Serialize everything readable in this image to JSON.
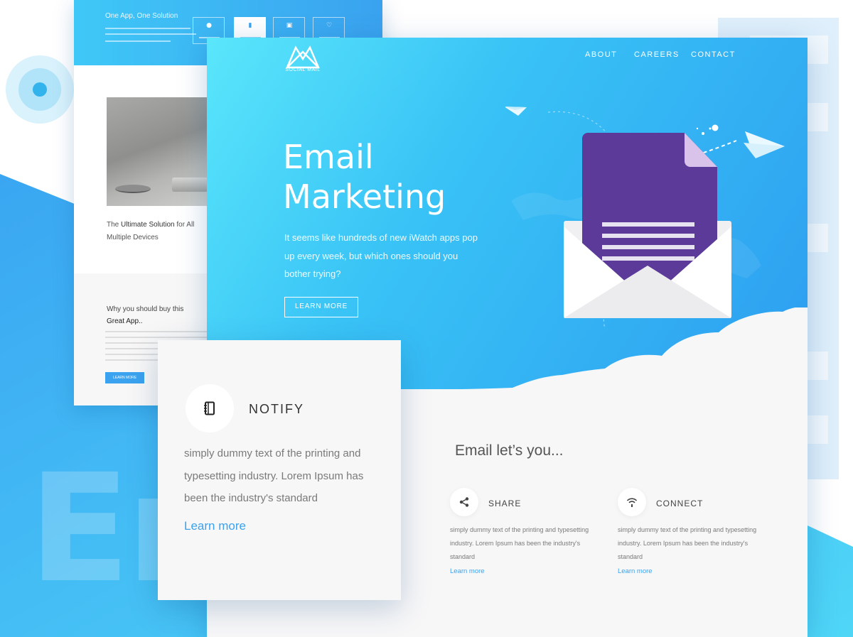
{
  "background": {
    "ghost_text": "Er"
  },
  "back_page": {
    "title": "One App, One Solution",
    "caption_prefix": "The ",
    "caption_bold": "Ultimate Solution",
    "caption_suffix": " for All",
    "caption_line2": "Multiple Devices",
    "why_line1": "Why you should buy this",
    "why_line2": "Great App..",
    "button_label": "LEARN MORE"
  },
  "header": {
    "logo_text": "SOCIAL MAIL",
    "nav": [
      "ABOUT",
      "CAREERS",
      "CONTACT"
    ]
  },
  "hero": {
    "title_line1": "Email",
    "title_line2": "Marketing",
    "subtitle": "It seems like hundreds of new iWatch apps pop up every week, but which ones should you bother trying?",
    "button_label": "LEARN MORE"
  },
  "notify_card": {
    "title": "NOTIFY",
    "description": "simply dummy text of the printing and typesetting industry. Lorem Ipsum has been the industry's standard",
    "link": "Learn more"
  },
  "features": {
    "heading": "Email let’s you...",
    "items": [
      {
        "icon": "share-icon",
        "title": "SHARE",
        "description": "simply dummy text of the printing and typesetting industry. Lorem Ipsum has been the industry's standard",
        "link": "Learn more"
      },
      {
        "icon": "wifi-icon",
        "title": "CONNECT",
        "description": "simply dummy text of the printing and typesetting industry. Lorem Ipsum has been the industry's standard",
        "link": "Learn more"
      }
    ]
  },
  "colors": {
    "accent": "#3aa2ef",
    "hero_start": "#5ae6fb",
    "hero_end": "#2d9ef0",
    "envelope_letter": "#5b3a9a"
  }
}
